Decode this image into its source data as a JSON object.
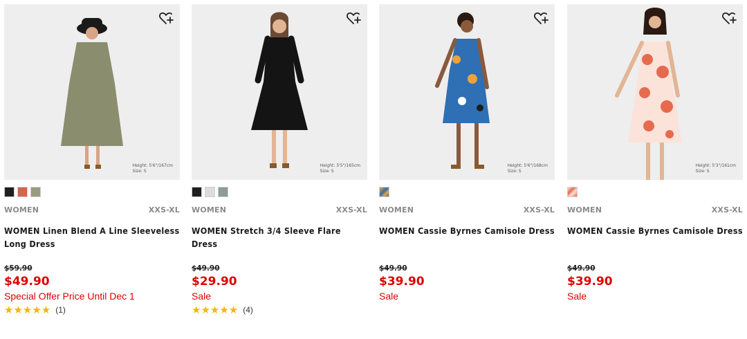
{
  "products": [
    {
      "photo_measure_height": "Height: 5'6\"/167cm",
      "photo_measure_size": "Size: S",
      "dress_color": "#8a8e6e",
      "swatches": [
        "#1f1f1f",
        "#d6634d",
        "#9a9d7d"
      ],
      "gender": "WOMEN",
      "size_range": "XXS-XL",
      "name": "WOMEN Linen Blend A Line Sleeveless Long Dress",
      "old_price": "$59.90",
      "price": "$49.90",
      "flag": "Special Offer Price Until Dec 1",
      "stars": "★★★★★",
      "reviews": "(1)"
    },
    {
      "photo_measure_height": "Height: 5'5\"/165cm",
      "photo_measure_size": "Size: S",
      "dress_color": "#141414",
      "swatches": [
        "#1f1f1f",
        "#dcdcdc",
        "#8f9a9c"
      ],
      "gender": "WOMEN",
      "size_range": "XXS-XL",
      "name": "WOMEN Stretch 3/4 Sleeve Flare Dress",
      "old_price": "$49.90",
      "price": "$29.90",
      "flag": "Sale",
      "stars": "★★★★★",
      "reviews": "(4)"
    },
    {
      "photo_measure_height": "Height: 5'6\"/168cm",
      "photo_measure_size": "Size: S",
      "dress_color": "#2f6fb3",
      "swatches": [
        "#2f6fb3"
      ],
      "gender": "WOMEN",
      "size_range": "XXS-XL",
      "name": "WOMEN Cassie Byrnes Camisole Dress",
      "old_price": "$49.90",
      "price": "$39.90",
      "flag": "Sale",
      "stars": "",
      "reviews": ""
    },
    {
      "photo_measure_height": "Height: 5'3\"/161cm",
      "photo_measure_size": "Size: S",
      "dress_color": "#e66a4d",
      "swatches": [
        "#e66a4d"
      ],
      "gender": "WOMEN",
      "size_range": "XXS-XL",
      "name": "WOMEN Cassie Byrnes Camisole Dress",
      "old_price": "$49.90",
      "price": "$39.90",
      "flag": "Sale",
      "stars": "",
      "reviews": ""
    }
  ],
  "icons": {
    "favorite": "heart-plus-icon",
    "rating": "star-icon"
  }
}
